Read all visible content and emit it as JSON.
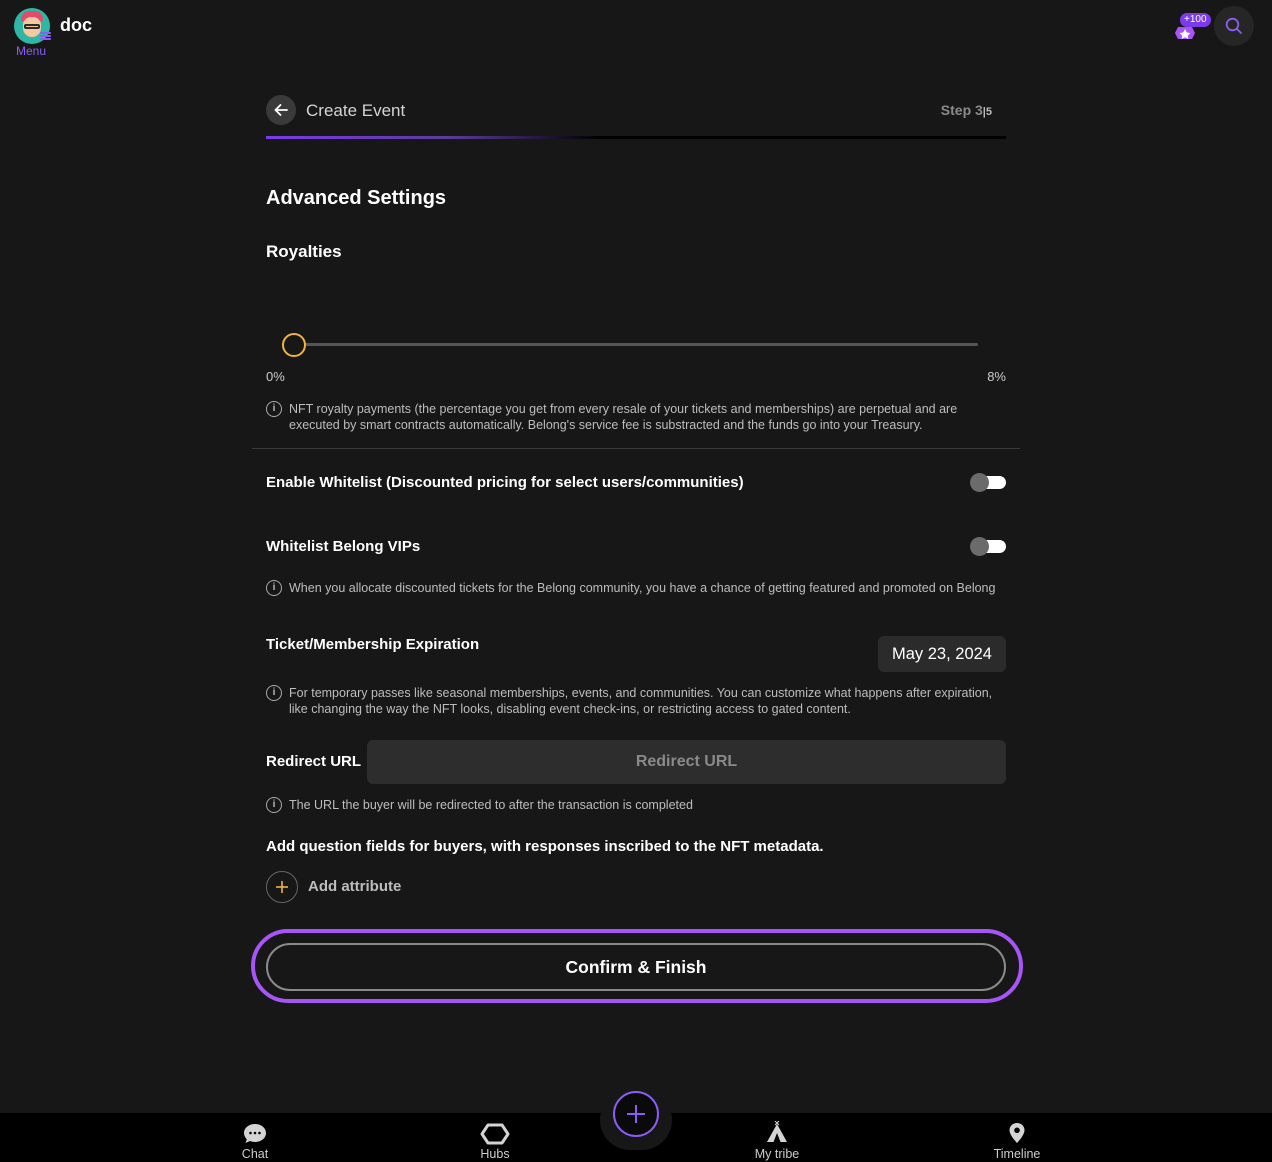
{
  "topbar": {
    "username": "doc",
    "menu_label": "Menu",
    "badge_count": "+100"
  },
  "header": {
    "title": "Create Event",
    "step_label": "Step 3",
    "step_total": "5",
    "progress_fraction": 0.6
  },
  "advanced": {
    "title": "Advanced Settings",
    "royalties": {
      "title": "Royalties",
      "value_percent": 0,
      "min_label": "0%",
      "max_label": "8%",
      "info": "NFT royalty payments (the percentage you get from every resale of your tickets and memberships) are perpetual and are executed by smart contracts automatically. Belong's service fee is substracted and the funds go into your Treasury."
    },
    "whitelist": {
      "label": "Enable Whitelist (Discounted pricing for select users/communities)",
      "enabled": false
    },
    "vips": {
      "label": "Whitelist Belong VIPs",
      "enabled": false,
      "info": "When you allocate discounted tickets for the Belong community, you have a chance of getting featured and promoted on Belong"
    },
    "expiration": {
      "label": "Ticket/Membership Expiration",
      "date": "May 23, 2024",
      "info": "For temporary passes like seasonal memberships, events, and communities. You can customize what happens after expiration, like changing the way the NFT looks, disabling event check-ins, or restricting access to gated content."
    },
    "redirect": {
      "label": "Redirect URL",
      "placeholder": "Redirect URL",
      "value": "",
      "info": "The URL the buyer will be redirected to after the transaction is completed"
    },
    "questions": {
      "label": "Add question fields for buyers, with responses inscribed to the NFT metadata.",
      "add_label": "Add attribute"
    },
    "confirm_label": "Confirm & Finish"
  },
  "bottom_nav": {
    "items": [
      {
        "label": "Chat",
        "icon": "chat-icon"
      },
      {
        "label": "Hubs",
        "icon": "hubs-icon"
      },
      {
        "label": "My tribe",
        "icon": "tent-icon"
      },
      {
        "label": "Timeline",
        "icon": "location-pin-icon"
      }
    ],
    "fab_icon": "plus-icon"
  },
  "colors": {
    "accent": "#8b5cf6",
    "background": "#171717",
    "slider_thumb": "#f0b43c",
    "confirm_highlight": "#a855f7"
  }
}
